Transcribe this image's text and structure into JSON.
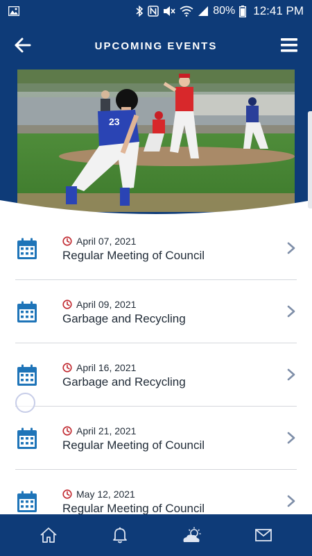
{
  "status_bar": {
    "battery": "80%",
    "time": "12:41 PM"
  },
  "header": {
    "title": "UPCOMING EVENTS"
  },
  "events": [
    {
      "date": "April 07, 2021",
      "title": "Regular Meeting of Council"
    },
    {
      "date": "April 09, 2021",
      "title": "Garbage and Recycling"
    },
    {
      "date": "April 16, 2021",
      "title": "Garbage and Recycling"
    },
    {
      "date": "April 21, 2021",
      "title": "Regular Meeting of Council"
    },
    {
      "date": "May 12, 2021",
      "title": "Regular Meeting of Council"
    }
  ],
  "bottom_nav": [
    {
      "icon": "home-icon"
    },
    {
      "icon": "bell-icon"
    },
    {
      "icon": "weather-icon"
    },
    {
      "icon": "mail-icon"
    }
  ],
  "colors": {
    "brand": "#0e3b78",
    "accent_icon": "#1e74b8",
    "clock_red": "#c0262d",
    "chevron": "#7e8ea8"
  }
}
